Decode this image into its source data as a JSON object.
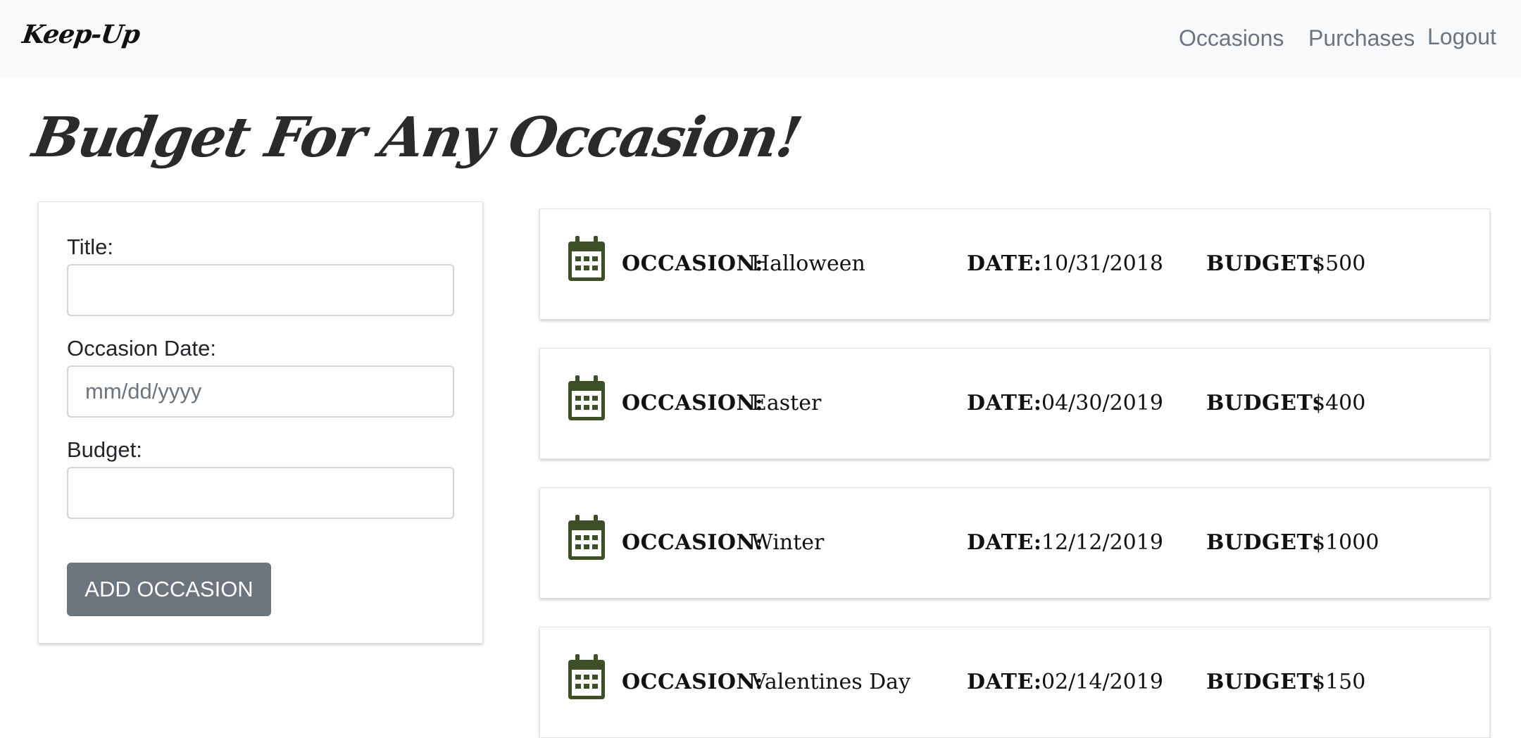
{
  "nav": {
    "brand": "Keep-Up",
    "links": [
      "Occasions",
      "Purchases",
      "Logout"
    ]
  },
  "page": {
    "title": "Budget For Any Occasion!"
  },
  "form": {
    "title_label": "Title:",
    "title_value": "",
    "date_label": "Occasion Date:",
    "date_placeholder": "mm/dd/yyyy",
    "budget_label": "Budget:",
    "budget_value": "",
    "submit_label": "ADD OCCASION"
  },
  "labels": {
    "occasion": "OCCASION:",
    "date": "DATE:",
    "budget": "BUDGET:"
  },
  "occasions": [
    {
      "name": "Halloween",
      "date": "10/31/2018",
      "budget": "$500"
    },
    {
      "name": "Easter",
      "date": "04/30/2019",
      "budget": "$400"
    },
    {
      "name": "Winter",
      "date": "12/12/2019",
      "budget": "$1000"
    },
    {
      "name": "Valentines Day",
      "date": "02/14/2019",
      "budget": "$150"
    }
  ],
  "colors": {
    "navbar_bg": "#f8f9fa",
    "nav_link": "#6c757d",
    "button_bg": "#6c757d",
    "calendar_icon": "#3d4f27"
  },
  "icons": {
    "occasion_icon": "calendar-icon"
  }
}
